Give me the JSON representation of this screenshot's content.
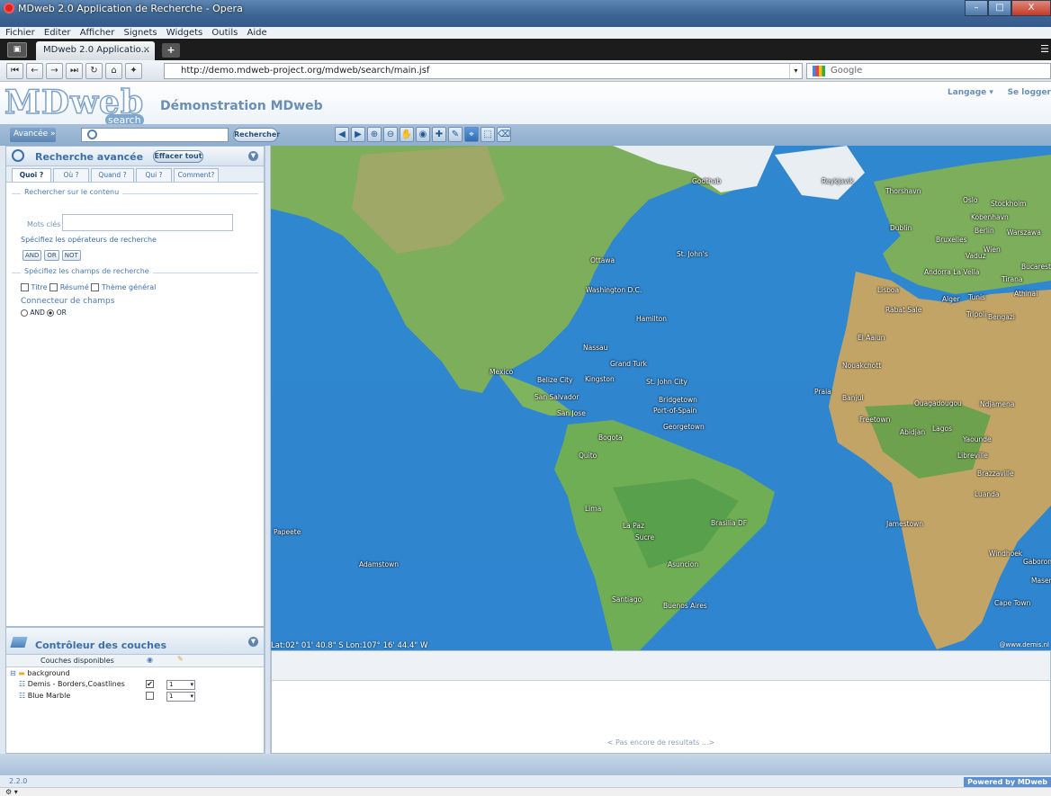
{
  "window": {
    "title": "MDweb 2.0 Application de Recherche - Opera",
    "min": "–",
    "max": "□",
    "close": "X"
  },
  "menu": [
    "Fichier",
    "Editer",
    "Afficher",
    "Signets",
    "Widgets",
    "Outils",
    "Aide"
  ],
  "tab": {
    "label": "MDweb 2.0 Applicatio...",
    "close": "×",
    "add": "+"
  },
  "nav": {
    "url": "http://demo.mdweb-project.org/mdweb/search/main.jsf",
    "search_engine": "Google"
  },
  "header": {
    "logo": "MDweb",
    "logo_sub": "search",
    "subtitle": "Démonstration MDweb",
    "language": "Langage ▾",
    "login": "Se logger"
  },
  "search": {
    "advanced_label": "Avancée »",
    "query": "",
    "button": "Rechercher"
  },
  "advanced": {
    "title": "Recherche avancée",
    "clear": "Effacer tout",
    "tabs": [
      "Quoi ?",
      "Où ?",
      "Quand ?",
      "Qui ?",
      "Comment?"
    ],
    "content_legend": "Rechercher sur le contenu",
    "keywords_label": "Mots clés",
    "keywords_value": "",
    "operators_label": "Spécifiez les opérateurs de recherche",
    "operators": [
      "AND",
      "OR",
      "NOT"
    ],
    "fields_legend": "Spécifiez les champs de recherche",
    "fields": [
      "Titre",
      "Résumé",
      "Thème général"
    ],
    "connector_label": "Connecteur de champs",
    "connector_options": [
      "AND",
      "OR"
    ],
    "connector_selected": "OR"
  },
  "layers": {
    "title": "Contrôleur des couches",
    "col_available": "Couches disponibles",
    "group": "background",
    "items": [
      {
        "name": "Demis - Borders,Coastlines",
        "checked": true,
        "order": "1"
      },
      {
        "name": "Blue Marble",
        "checked": false,
        "order": "1"
      }
    ]
  },
  "map": {
    "coords": "Lat:02° 01' 40.8\" S Lon:107° 16' 44.4\" W",
    "copyright": "@www.demis.nl",
    "cities": [
      {
        "name": "Godthab"
      },
      {
        "name": "Reykjavik"
      },
      {
        "name": "Thorshavn"
      },
      {
        "name": "Oslo"
      },
      {
        "name": "Stockholm"
      },
      {
        "name": "Kobenhavn"
      },
      {
        "name": "Dublin"
      },
      {
        "name": "Berlin"
      },
      {
        "name": "Warszawa"
      },
      {
        "name": "Bruxelles"
      },
      {
        "name": "Wien"
      },
      {
        "name": "Vaduz"
      },
      {
        "name": "St. John's"
      },
      {
        "name": "Ottawa"
      },
      {
        "name": "Andorra La Vella"
      },
      {
        "name": "Bucarest"
      },
      {
        "name": "Tirana"
      },
      {
        "name": "Washington D.C."
      },
      {
        "name": "Lisboa"
      },
      {
        "name": "Alger"
      },
      {
        "name": "Tunis"
      },
      {
        "name": "Athinai"
      },
      {
        "name": "Rabat Sale"
      },
      {
        "name": "Tripoli"
      },
      {
        "name": "Bengazi"
      },
      {
        "name": "Hamilton"
      },
      {
        "name": "El Aaiun"
      },
      {
        "name": "Nassau"
      },
      {
        "name": "Grand Turk"
      },
      {
        "name": "Nouakchott"
      },
      {
        "name": "Mexico"
      },
      {
        "name": "Belize City"
      },
      {
        "name": "Kingston"
      },
      {
        "name": "St. John City"
      },
      {
        "name": "Praia"
      },
      {
        "name": "Banjul"
      },
      {
        "name": "Ouagadougou"
      },
      {
        "name": "Ndjamena"
      },
      {
        "name": "San Salvador"
      },
      {
        "name": "Bridgetown"
      },
      {
        "name": "Port-of-Spain"
      },
      {
        "name": "San Jose"
      },
      {
        "name": "Freetown"
      },
      {
        "name": "Georgetown"
      },
      {
        "name": "Abidjan"
      },
      {
        "name": "Lagos"
      },
      {
        "name": "Bogota"
      },
      {
        "name": "Yaounde"
      },
      {
        "name": "Quito"
      },
      {
        "name": "Libreville"
      },
      {
        "name": "Brazzaville"
      },
      {
        "name": "Luanda"
      },
      {
        "name": "Lima"
      },
      {
        "name": "La Paz"
      },
      {
        "name": "Brasilia DF"
      },
      {
        "name": "Papeete"
      },
      {
        "name": "Sucre"
      },
      {
        "name": "Jamestown"
      },
      {
        "name": "Windhoek"
      },
      {
        "name": "Gaborone"
      },
      {
        "name": "Adamstown"
      },
      {
        "name": "Asuncion"
      },
      {
        "name": "Maseru"
      },
      {
        "name": "Santiago"
      },
      {
        "name": "Buenos Aires"
      },
      {
        "name": "Cape Town"
      }
    ]
  },
  "results": {
    "message": "< Pas encore de resultats ...>"
  },
  "footer": {
    "version": "2.2.0",
    "powered": "Powered by MDweb"
  }
}
